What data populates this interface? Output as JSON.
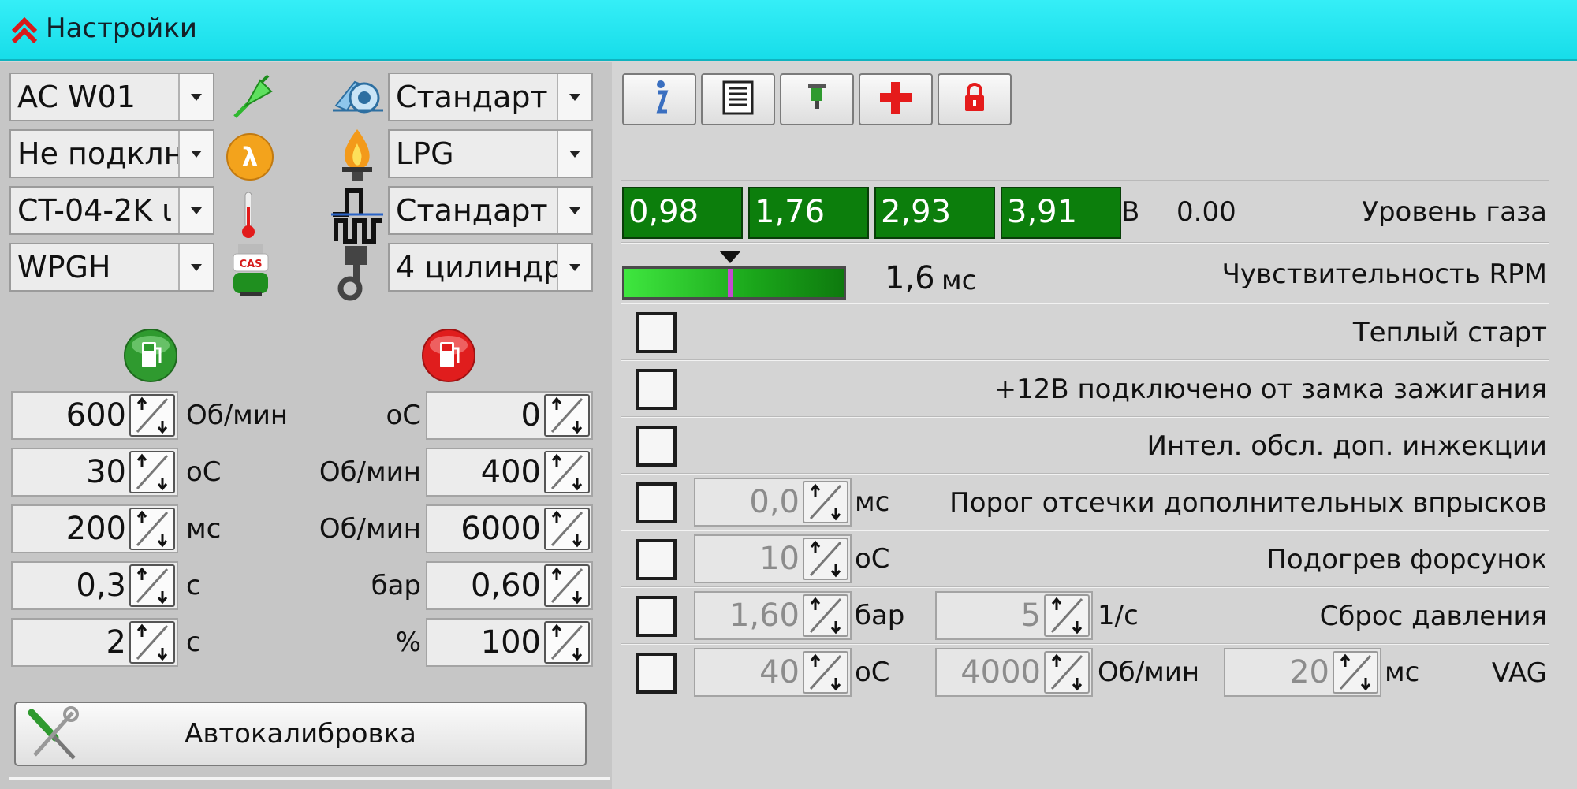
{
  "window": {
    "title": "Настройки"
  },
  "left": {
    "combos_left": [
      "AC W01",
      "Не подклн",
      "CT-04-2K ι",
      "WPGH"
    ],
    "combos_right": [
      "Стандарт",
      "LPG",
      "Стандарт",
      "4 цилиндр"
    ],
    "spins_left": [
      {
        "value": "600",
        "unit": "Об/мин"
      },
      {
        "value": "30",
        "unit": "оС"
      },
      {
        "value": "200",
        "unit": "мс"
      },
      {
        "value": "0,3",
        "unit": "с"
      },
      {
        "value": "2",
        "unit": "с"
      }
    ],
    "spins_right": [
      {
        "value": "0",
        "unit": "оС"
      },
      {
        "value": "400",
        "unit": "Об/мин"
      },
      {
        "value": "6000",
        "unit": "Об/мин"
      },
      {
        "value": "0,60",
        "unit": "бар"
      },
      {
        "value": "100",
        "unit": "%"
      }
    ],
    "cas_label": "CAS",
    "autocalibration_label": "Автокалибровка"
  },
  "right": {
    "gas_level": {
      "values": [
        "0,98",
        "1,76",
        "2,93",
        "3,91"
      ],
      "unit": "В",
      "current": "0.00",
      "label": "Уровень газа"
    },
    "rpm_sensitivity": {
      "value": "1,6",
      "unit": "мс",
      "label": "Чувствительность RPM",
      "marker_fraction": 0.47
    },
    "options": {
      "warm_start": "Теплый старт",
      "ignition_12v": "+12В подключено от замка зажигания",
      "intel_service": "Интел. обсл. доп. инжекции",
      "cutoff": {
        "label": "Порог отсечки дополнительных впрысков",
        "value": "0,0",
        "unit": "мс"
      },
      "injector_heating": {
        "label": "Подогрев форсунок",
        "value": "10",
        "unit": "оС"
      },
      "pressure_reset": {
        "label": "Сброс давления",
        "value1": "1,60",
        "unit1": "бар",
        "value2": "5",
        "unit2": "1/с"
      },
      "vag": {
        "label": "VAG",
        "value1": "40",
        "unit1": "оС",
        "value2": "4000",
        "unit2": "Об/мин",
        "value3": "20",
        "unit3": "мс"
      }
    }
  },
  "colors": {
    "titlebar": "#1ee4ee",
    "gas_cell": "#0c7e0c",
    "accent_red": "#e51b1b",
    "accent_green": "#2f9a2f"
  }
}
